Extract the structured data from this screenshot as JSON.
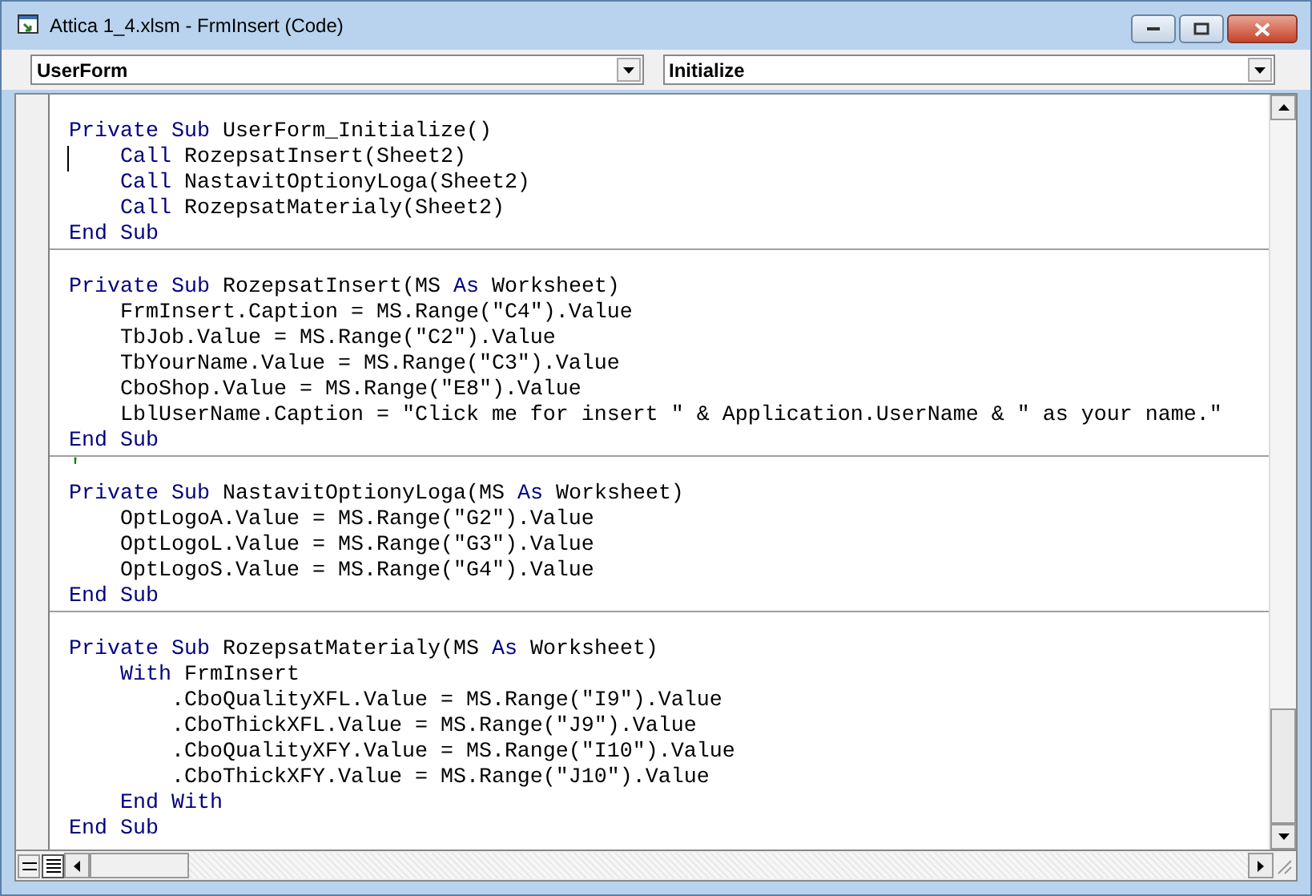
{
  "window": {
    "title": "Attica 1_4.xlsm - FrmInsert (Code)"
  },
  "object_dropdown": {
    "value": "UserForm"
  },
  "procedure_dropdown": {
    "value": "Initialize"
  },
  "view_buttons": [
    {
      "kind": "procedure",
      "selected": false
    },
    {
      "kind": "module",
      "selected": true
    }
  ],
  "procedures": [
    {
      "lines": [
        {
          "caret": false,
          "tokens": [
            {
              "text": "Private Sub ",
              "kind": "keyword"
            },
            {
              "text": "UserForm_Initialize()",
              "kind": "plain"
            }
          ]
        },
        {
          "caret": true,
          "tokens": [
            {
              "text": "    Call ",
              "kind": "keyword"
            },
            {
              "text": "RozepsatInsert(Sheet2)",
              "kind": "plain"
            }
          ]
        },
        {
          "caret": false,
          "tokens": [
            {
              "text": "    Call ",
              "kind": "keyword"
            },
            {
              "text": "NastavitOptionyLoga(Sheet2)",
              "kind": "plain"
            }
          ]
        },
        {
          "caret": false,
          "tokens": [
            {
              "text": "    Call ",
              "kind": "keyword"
            },
            {
              "text": "RozepsatMaterialy(Sheet2)",
              "kind": "plain"
            }
          ]
        },
        {
          "caret": false,
          "tokens": [
            {
              "text": "End Sub",
              "kind": "keyword"
            }
          ]
        }
      ]
    },
    {
      "lines": [
        {
          "caret": false,
          "tokens": [
            {
              "text": "Private Sub ",
              "kind": "keyword"
            },
            {
              "text": "RozepsatInsert(MS ",
              "kind": "plain"
            },
            {
              "text": "As ",
              "kind": "keyword"
            },
            {
              "text": "Worksheet)",
              "kind": "plain"
            }
          ]
        },
        {
          "caret": false,
          "tokens": [
            {
              "text": "    FrmInsert.Caption = MS.Range(\"C4\").Value",
              "kind": "plain"
            }
          ]
        },
        {
          "caret": false,
          "tokens": [
            {
              "text": "    TbJob.Value = MS.Range(\"C2\").Value",
              "kind": "plain"
            }
          ]
        },
        {
          "caret": false,
          "tokens": [
            {
              "text": "    TbYourName.Value = MS.Range(\"C3\").Value",
              "kind": "plain"
            }
          ]
        },
        {
          "caret": false,
          "tokens": [
            {
              "text": "    CboShop.Value = MS.Range(\"E8\").Value",
              "kind": "plain"
            }
          ]
        },
        {
          "caret": false,
          "tokens": [
            {
              "text": "    LblUserName.Caption = \"Click me for insert \" & Application.UserName & \" as your name.\"",
              "kind": "plain"
            }
          ]
        },
        {
          "caret": false,
          "tokens": [
            {
              "text": "End Sub",
              "kind": "keyword"
            }
          ]
        }
      ]
    },
    {
      "lead": "'",
      "lines": [
        {
          "caret": false,
          "tokens": [
            {
              "text": "Private Sub ",
              "kind": "keyword"
            },
            {
              "text": "NastavitOptionyLoga(MS ",
              "kind": "plain"
            },
            {
              "text": "As ",
              "kind": "keyword"
            },
            {
              "text": "Worksheet)",
              "kind": "plain"
            }
          ]
        },
        {
          "caret": false,
          "tokens": [
            {
              "text": "    OptLogoA.Value = MS.Range(\"G2\").Value",
              "kind": "plain"
            }
          ]
        },
        {
          "caret": false,
          "tokens": [
            {
              "text": "    OptLogoL.Value = MS.Range(\"G3\").Value",
              "kind": "plain"
            }
          ]
        },
        {
          "caret": false,
          "tokens": [
            {
              "text": "    OptLogoS.Value = MS.Range(\"G4\").Value",
              "kind": "plain"
            }
          ]
        },
        {
          "caret": false,
          "tokens": [
            {
              "text": "End Sub",
              "kind": "keyword"
            }
          ]
        }
      ]
    },
    {
      "lines": [
        {
          "caret": false,
          "tokens": [
            {
              "text": "Private Sub ",
              "kind": "keyword"
            },
            {
              "text": "RozepsatMaterialy(MS ",
              "kind": "plain"
            },
            {
              "text": "As ",
              "kind": "keyword"
            },
            {
              "text": "Worksheet)",
              "kind": "plain"
            }
          ]
        },
        {
          "caret": false,
          "tokens": [
            {
              "text": "    With ",
              "kind": "keyword"
            },
            {
              "text": "FrmInsert",
              "kind": "plain"
            }
          ]
        },
        {
          "caret": false,
          "tokens": [
            {
              "text": "        .CboQualityXFL.Value = MS.Range(\"I9\").Value",
              "kind": "plain"
            }
          ]
        },
        {
          "caret": false,
          "tokens": [
            {
              "text": "        .CboThickXFL.Value = MS.Range(\"J9\").Value",
              "kind": "plain"
            }
          ]
        },
        {
          "caret": false,
          "tokens": [
            {
              "text": "        .CboQualityXFY.Value = MS.Range(\"I10\").Value",
              "kind": "plain"
            }
          ]
        },
        {
          "caret": false,
          "tokens": [
            {
              "text": "        .CboThickXFY.Value = MS.Range(\"J10\").Value",
              "kind": "plain"
            }
          ]
        },
        {
          "caret": false,
          "tokens": [
            {
              "text": "    End With",
              "kind": "keyword"
            }
          ]
        },
        {
          "caret": false,
          "tokens": [
            {
              "text": "End Sub",
              "kind": "keyword"
            }
          ]
        }
      ]
    }
  ]
}
